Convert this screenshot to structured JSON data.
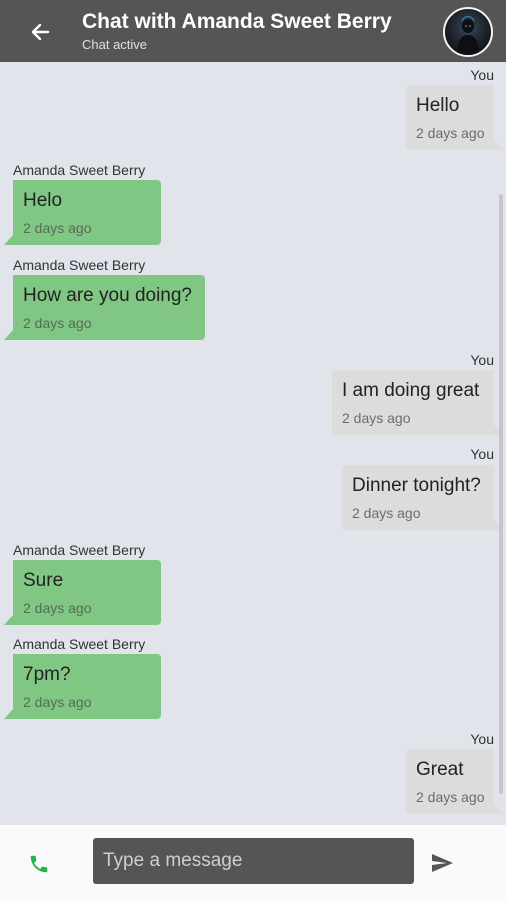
{
  "header": {
    "title": "Chat with Amanda Sweet Berry",
    "status": "Chat active",
    "back_icon": "arrow-left-icon",
    "avatar_icon": "contact-avatar"
  },
  "messages": [
    {
      "sender": "You",
      "text": "Hello",
      "time": "2 days ago",
      "direction": "out"
    },
    {
      "sender": "Amanda Sweet Berry",
      "text": "Helo",
      "time": "2 days ago",
      "direction": "in"
    },
    {
      "sender": "Amanda Sweet Berry",
      "text": "How are you doing?",
      "time": "2 days ago",
      "direction": "in"
    },
    {
      "sender": "You",
      "text": "I am doing great",
      "time": "2 days ago",
      "direction": "out"
    },
    {
      "sender": "You",
      "text": "Dinner tonight?",
      "time": "2 days ago",
      "direction": "out"
    },
    {
      "sender": "Amanda Sweet Berry",
      "text": "Sure",
      "time": "2 days ago",
      "direction": "in"
    },
    {
      "sender": "Amanda Sweet Berry",
      "text": "7pm?",
      "time": "2 days ago",
      "direction": "in"
    },
    {
      "sender": "You",
      "text": "Great",
      "time": "2 days ago",
      "direction": "out"
    }
  ],
  "composer": {
    "placeholder": "Type a message",
    "call_icon": "phone-icon",
    "send_icon": "send-icon"
  },
  "colors": {
    "header_bg": "#555555",
    "incoming_bubble": "#81c784",
    "outgoing_bubble": "#dcdcdc",
    "chat_bg": "#e2e4ec",
    "call_icon": "#22b34a"
  }
}
